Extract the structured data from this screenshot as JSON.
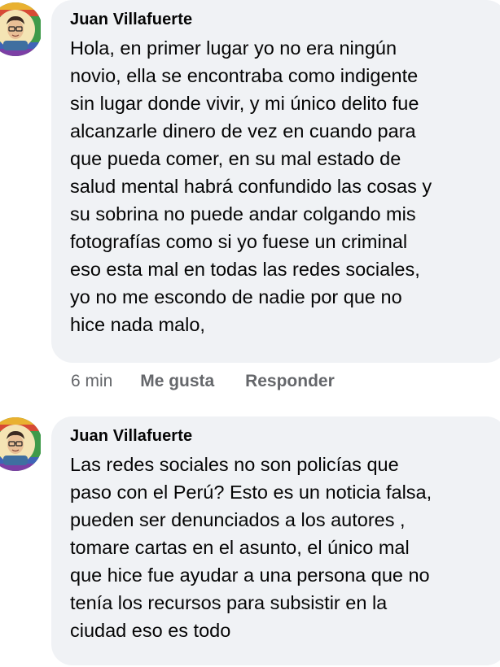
{
  "comments": [
    {
      "author": "Juan Villafuerte",
      "lines": [
        "Hola, en primer lugar yo no era ningún",
        "novio, ella se encontraba como indigente",
        "sin lugar donde vivir, y mi único delito fue",
        "alcanzarle dinero de vez en cuando para",
        "que pueda comer, en su mal estado de",
        "salud mental habrá confundido las cosas y",
        "su sobrina no puede andar colgando mis",
        "fotografías como si yo fuese un criminal",
        "eso esta mal en todas las redes sociales,",
        "yo no me escondo de nadie por que no",
        "hice nada malo,"
      ],
      "time": "6 min",
      "like_label": "Me gusta",
      "reply_label": "Responder"
    },
    {
      "author": "Juan Villafuerte",
      "lines": [
        "Las redes sociales no son policías que",
        "paso con el Perú? Esto es un noticia falsa,",
        "pueden ser denunciados a los autores ,",
        "tomare cartas en el asunto, el único mal",
        "que hice fue ayudar a una persona que no",
        "tenía los recursos para subsistir en la",
        "ciudad eso es todo"
      ]
    }
  ],
  "colors": {
    "bubble": "#f0f2f5",
    "text": "#050505",
    "meta": "#65676b"
  },
  "icons": {
    "avatar": "cartoon-avatar-icon"
  }
}
